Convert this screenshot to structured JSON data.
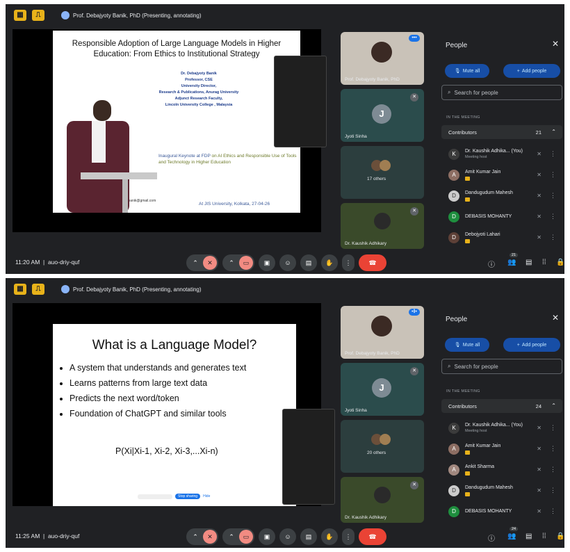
{
  "screens": [
    {
      "presenter_banner": "Prof. Debajyoty Banik, PhD (Presenting, annotating)",
      "slide": {
        "title": "Responsible Adoption of Large Language Models in Higher Education: From Ethics to Institutional Strategy",
        "speaker_lines": [
          "Dr. Debajyoty Banik",
          "Professor, CSE",
          "University Director,",
          "Research & Publications, Anurag University",
          "Adjunct Research Faculty,",
          "Lincoln University College , Malaysia"
        ],
        "keynote_lead": "Inaugural Keynote at FDP",
        "keynote_rest": " on AI Ethics and Responsible Use of Tools and Technology in Higher Education",
        "venue": "At JIS University, Kolkata, 27-04-26",
        "email": "debajyoty.banik@gmail.com"
      },
      "tiles": {
        "presenter_name": "Prof. Debajyoty Banik, PhD",
        "jyoti_initial": "J",
        "jyoti_name": "Jyoti Sinha",
        "others": "17 others",
        "kaushik_name": "Dr. Kaushik Adhikary"
      },
      "people": {
        "title": "People",
        "mute_all": "Mute all",
        "add_people": "Add people",
        "search_placeholder": "Search for people",
        "section": "IN THE MEETING",
        "contributors_label": "Contributors",
        "contributors_count": "21",
        "list": [
          {
            "name": "Dr. Kaushik Adhika... (You)",
            "sub": "Meeting host",
            "initial": "K"
          },
          {
            "name": "Amit Kumar Jain",
            "sub": "",
            "initial": "A"
          },
          {
            "name": "Dandugudum Mahesh",
            "sub": "",
            "initial": "D"
          },
          {
            "name": "DEBASIS MOHANTY",
            "sub": "",
            "initial": "D"
          },
          {
            "name": "Debojyoti Lahari",
            "sub": "",
            "initial": "D"
          }
        ]
      },
      "bottom": {
        "time": "11:20 AM",
        "code": "auo-driy-quf",
        "people_count": "21"
      }
    },
    {
      "presenter_banner": "Prof. Debajyoty Banik, PhD (Presenting, annotating)",
      "slide": {
        "title": "What is a Language Model?",
        "bullets": [
          "A system that understands and generates text",
          "Learns patterns from large text data",
          "Predicts the next word/token",
          "Foundation of ChatGPT and similar tools"
        ],
        "formula": "P(Xi|Xi-1, Xi-2, Xi-3,...Xi-n)",
        "stop_sharing": "Stop sharing",
        "hide": "Hide"
      },
      "tiles": {
        "presenter_name": "Prof. Debajyoty Banik, PhD",
        "jyoti_initial": "J",
        "jyoti_name": "Jyoti Sinha",
        "others": "20 others",
        "kaushik_name": "Dr. Kaushik Adhikary"
      },
      "people": {
        "title": "People",
        "mute_all": "Mute all",
        "add_people": "Add people",
        "search_placeholder": "Search for people",
        "section": "IN THE MEETING",
        "contributors_label": "Contributors",
        "contributors_count": "24",
        "list": [
          {
            "name": "Dr. Kaushik Adhika... (You)",
            "sub": "Meeting host",
            "initial": "K"
          },
          {
            "name": "Amit Kumar Jain",
            "sub": "",
            "initial": "A"
          },
          {
            "name": "Ankit Sharma",
            "sub": "",
            "initial": "A"
          },
          {
            "name": "Dandugudum Mahesh",
            "sub": "",
            "initial": "D"
          },
          {
            "name": "DEBASIS MOHANTY",
            "sub": "",
            "initial": "D"
          }
        ]
      },
      "bottom": {
        "time": "11:25 AM",
        "code": "auo-driy-quf",
        "people_count": "24"
      }
    }
  ],
  "colors": {
    "accent": "#174ea6",
    "end_call": "#ea4335",
    "host_badge": "#e8b21a",
    "debasis_avatar": "#1e8e3e"
  },
  "icons": [
    "grid-layout-icon",
    "door-icon",
    "mic-off-icon",
    "camera-off-icon",
    "present-icon",
    "emoji-icon",
    "captions-icon",
    "raise-hand-icon",
    "more-vert-icon",
    "end-call-icon",
    "info-icon",
    "people-icon",
    "chat-icon",
    "activities-icon",
    "lock-icon",
    "search-icon",
    "close-icon"
  ]
}
